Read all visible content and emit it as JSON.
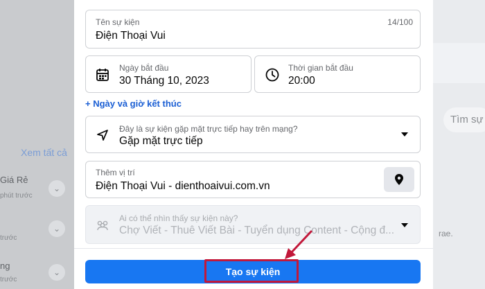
{
  "background": {
    "see_all": "Xem tất cả",
    "item1_title": "Giá Rẻ",
    "item1_sub": "phút trước",
    "item2_sub": "trước",
    "item3_title": "ng",
    "item3_sub": "trước",
    "search_placeholder": "Tìm sự",
    "side_text": "rae."
  },
  "form": {
    "event_name": {
      "label": "Tên sự kiện",
      "value": "Điện Thoại Vui",
      "counter": "14/100"
    },
    "start_date": {
      "label": "Ngày bắt đầu",
      "value": "30 Tháng 10, 2023",
      "icon": "calendar-icon"
    },
    "start_time": {
      "label": "Thời gian bắt đầu",
      "value": "20:00",
      "icon": "clock-icon"
    },
    "end_link": "+ Ngày và giờ kết thúc",
    "event_type": {
      "label": "Đây là sự kiện gặp mặt trực tiếp hay trên mạng?",
      "value": "Gặp mặt trực tiếp",
      "icon": "navigation-arrow-icon"
    },
    "location": {
      "label": "Thêm vị trí",
      "value": "Điện Thoại Vui - dienthoaivui.com.vn",
      "icon": "map-pin-icon"
    },
    "privacy": {
      "label": "Ai có thể nhìn thấy sự kiện này?",
      "value": "Chợ Viết - Thuê Viết Bài - Tuyển dụng Content - Cộng đ...",
      "icon": "group-icon"
    },
    "submit_label": "Tạo sự kiện"
  },
  "colors": {
    "primary": "#1877f2",
    "highlight": "#c2183a",
    "link": "#1b5fd4"
  }
}
